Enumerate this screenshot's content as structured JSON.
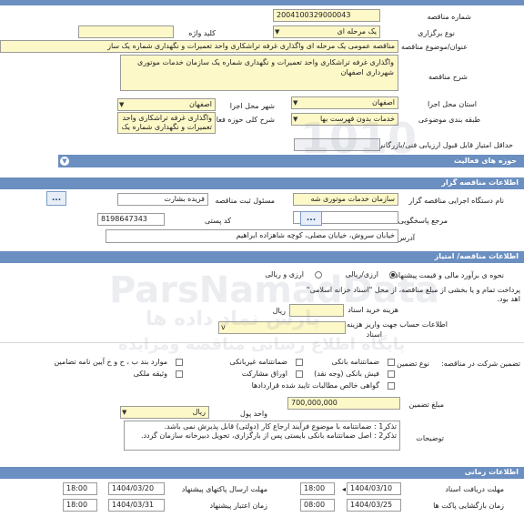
{
  "header": {
    "title": ""
  },
  "tender": {
    "number_label": "شماره مناقصه",
    "number_value": "2004100329000043",
    "hold_type_label": "نوع برگزاری",
    "hold_type_value": "یک مرحله ای",
    "keyword_label": "کلید واژه",
    "keyword_value": "",
    "subject_label": "عنوان/موضوع مناقصه",
    "subject_value": "مناقصه عمومی یک مرحله ای واگذاری غرفه تراشکاری واحد تعمیرات و نگهداری شماره یک ساز",
    "description_label": "شرح مناقصه",
    "description_value": "واگذاری غرفه تراشکاری واحد تعمیرات و نگهداری شماره یک سازمان خدمات موتوری شهرداری اصفهان",
    "province_label": "استان محل اجرا",
    "province_value": "اصفهان",
    "city_label": "شهر محل اجرا",
    "city_value": "اصفهان",
    "category_label": "طبقه بندی موضوعی",
    "category_value": "خدمات بدون فهرست بها",
    "activity_label": "شرح کلی حوزه فعالیت",
    "activity_value": "واگذاری غرفه تراشکاری واحد تعمیرات و نگهداری شماره یک",
    "min_score_label": "حداقل امتیاز قابل قبول ارزیابی فنی/بازرگانی",
    "min_score_value": "",
    "activity_areas_label": "حوزه های فعالیت"
  },
  "organizer": {
    "section_title": "اطلاعات مناقصه گزار",
    "agency_label": "نام دستگاه اجرایی مناقصه گزار",
    "agency_value": "سازمان خدمات موتوری شه",
    "responsible_label": "مسئول ثبت مناقصه",
    "responsible_value": "فریده بشارت",
    "reference_label": "مرجع پاسخگویی",
    "reference_value": "",
    "postal_label": "کد پستی",
    "postal_value": "8198647343",
    "address_label": "آدرس",
    "address_value": "خیابان سروش، خیابان مصلی، کوچه شاهزاده ابراهیم",
    "more_button": "...",
    "ref_button": "..."
  },
  "pricing": {
    "section_title": "اطلاعات مناقصه/ امتیاز",
    "proposal_method_label": "نحوه ی برآورد مالی و قیمت پیشنهادی",
    "option_a": "ارزی/ریالی",
    "option_b": "ارزی و ریالی",
    "payment_text_1": "پرداخت تمام و یا بخشی از مبلغ مناقصه، از محل \"اسناد خزانه اسلامی\"",
    "payment_text_2": "اهد بود.",
    "doc_fee_label": "هزینه خرید اسناد",
    "doc_fee_unit": "ریال",
    "doc_fee_value": "",
    "account_label_1": "اطلاعات حساب جهت واریز هزینه خرید",
    "account_label_2": "اسناد",
    "account_value": "",
    "account_arrow": "v"
  },
  "guarantee": {
    "participation_label": "تضمین شرکت در مناقصه:",
    "type_label": "نوع تضمین",
    "options": [
      "ضمانتنامه بانکی",
      "ضمانتنامه غیربانکی",
      "موارد بند ب ، ح و خ آیین نامه تضامین",
      "فیش بانکی (وجه نقد)",
      "اوراق مشارکت",
      "وثیقه ملکی",
      "گواهی خالص مطالبات تایید شده قراردادها"
    ],
    "amount_label": "مبلغ تضمین",
    "amount_value": "700,000,000",
    "currency_label": "واحد پول",
    "currency_value": "ریال",
    "notes_label": "توضیحات",
    "note_1": "تذکر1 : ضمانتنامه با موضوع فرآیند ارجاع کار (دولتی) قابل پذیرش نمی باشد.",
    "note_2": "تذکر2 : اصل ضمانتنامه بانکی بایستی پس از بارگزاری، تحویل دبیرخانه سازمان گردد."
  },
  "timing": {
    "section_title": "اطلاعات زمانی",
    "receive_deadline_label": "مهلت دریافت اسناد",
    "receive_deadline_date": "1404/03/10",
    "receive_deadline_time": "18:00",
    "send_deadline_label": "مهلت ارسال پاکتهای پیشنهاد",
    "send_deadline_date": "1404/03/20",
    "send_deadline_time": "18:00",
    "opening_label": "زمان بازگشایی پاکت ها",
    "opening_date": "1404/03/25",
    "opening_time": "08:00",
    "validity_label": "زمان اعتبار پیشنهاد",
    "validity_date": "1404/03/31",
    "validity_time": "18:00"
  },
  "watermark": {
    "text_1": "ParsNamadData",
    "text_2": "پارس نماد داده ها",
    "text_3": "پایگاه اطلاع رسانی مناقصه ومزایده",
    "text_4": "1010"
  }
}
